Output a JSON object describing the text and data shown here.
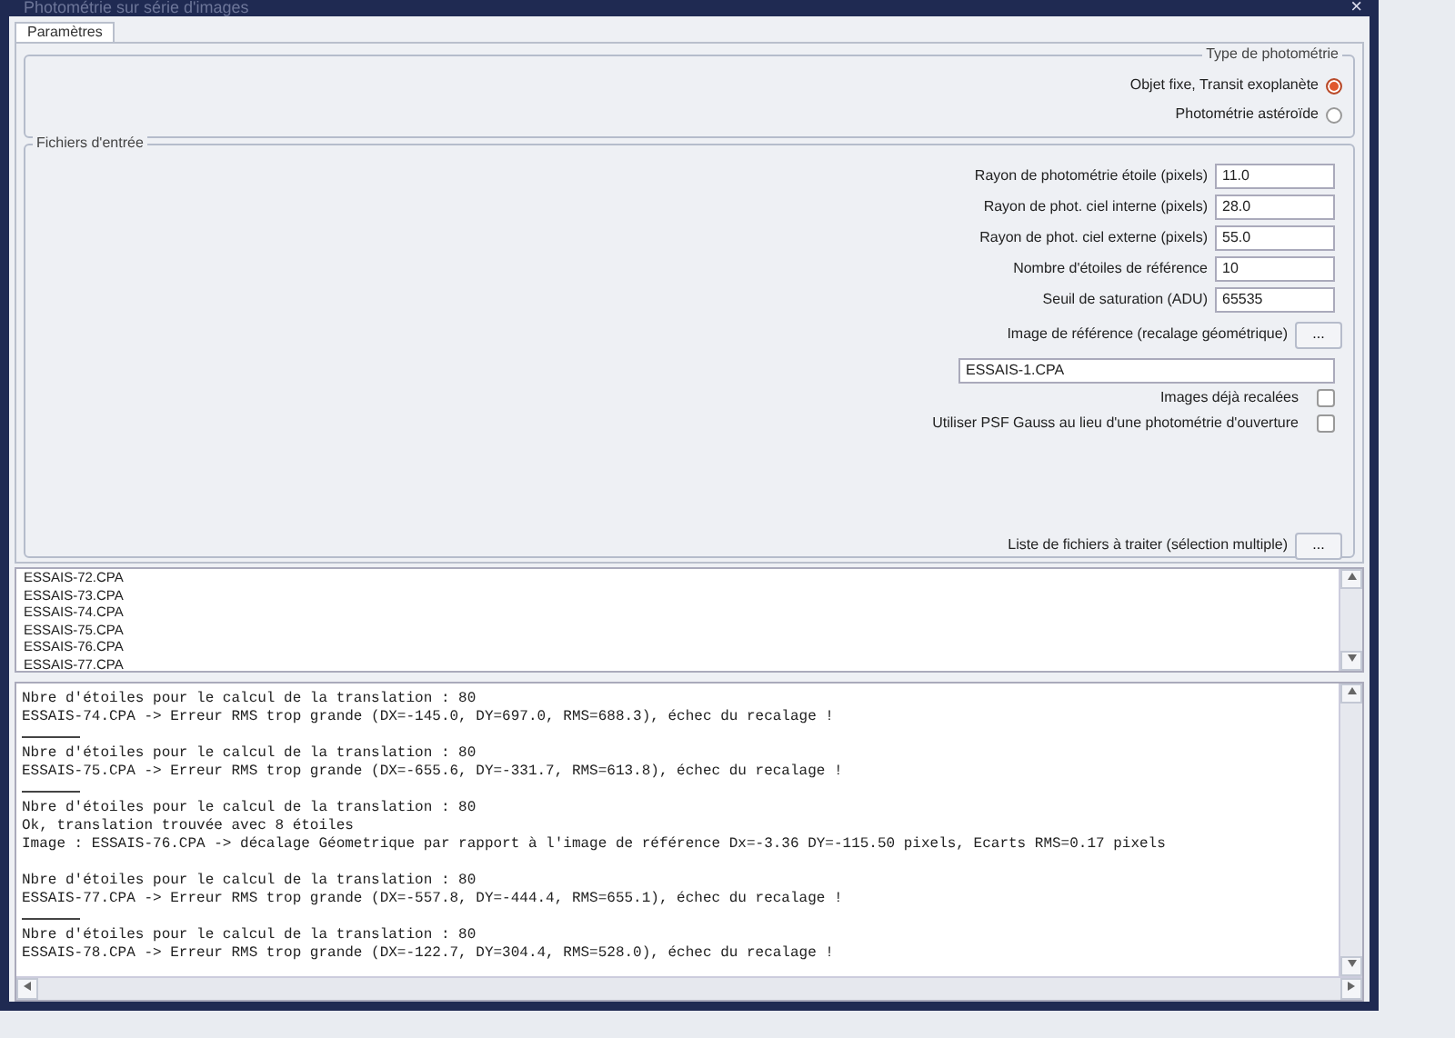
{
  "window": {
    "title": "Photométrie sur série d'images",
    "close": "×"
  },
  "tabs": [
    {
      "label": "Paramètres",
      "selected": true
    }
  ],
  "photometry_type": {
    "legend": "Type de photométrie",
    "options": [
      {
        "label": "Objet fixe, Transit exoplanète",
        "selected": true
      },
      {
        "label": "Photométrie astéroïde",
        "selected": false
      }
    ]
  },
  "input_files": {
    "legend": "Fichiers d'entrée",
    "fields": [
      {
        "label": "Rayon de photométrie étoile (pixels)",
        "value": "11.0"
      },
      {
        "label": "Rayon de phot. ciel interne (pixels)",
        "value": "28.0"
      },
      {
        "label": "Rayon de phot. ciel externe (pixels)",
        "value": "55.0"
      },
      {
        "label": "Nombre d'étoiles de référence",
        "value": "10"
      },
      {
        "label": "Seuil de saturation (ADU)",
        "value": "65535"
      }
    ],
    "reference": {
      "label": "Image de référence (recalage géométrique)",
      "button": "...",
      "value": "ESSAIS-1.CPA"
    },
    "checks": [
      {
        "label": "Images déjà recalées",
        "checked": false
      },
      {
        "label": "Utiliser PSF Gauss au lieu d'une photométrie d'ouverture",
        "checked": false
      }
    ],
    "file_list": {
      "label": "Liste de fichiers à traiter (sélection multiple)",
      "button": "..."
    }
  },
  "files": [
    "ESSAIS-72.CPA",
    "ESSAIS-73.CPA",
    "ESSAIS-74.CPA",
    "ESSAIS-75.CPA",
    "ESSAIS-76.CPA",
    "ESSAIS-77.CPA"
  ],
  "log": [
    {
      "kind": "text",
      "text": "Nbre d'étoiles pour le calcul de la translation : 80"
    },
    {
      "kind": "text",
      "text": "ESSAIS-74.CPA -> Erreur RMS trop grande (DX=-145.0, DY=697.0, RMS=688.3), échec du recalage !"
    },
    {
      "kind": "rule"
    },
    {
      "kind": "text",
      "text": "Nbre d'étoiles pour le calcul de la translation : 80"
    },
    {
      "kind": "text",
      "text": "ESSAIS-75.CPA -> Erreur RMS trop grande (DX=-655.6, DY=-331.7, RMS=613.8), échec du recalage !"
    },
    {
      "kind": "rule"
    },
    {
      "kind": "text",
      "text": "Nbre d'étoiles pour le calcul de la translation : 80"
    },
    {
      "kind": "text",
      "text": "Ok, translation trouvée avec 8 étoiles"
    },
    {
      "kind": "text",
      "text": "Image : ESSAIS-76.CPA -> décalage Géometrique par rapport à l'image de référence Dx=-3.36 DY=-115.50 pixels, Ecarts RMS=0.17 pixels"
    },
    {
      "kind": "blank"
    },
    {
      "kind": "text",
      "text": "Nbre d'étoiles pour le calcul de la translation : 80"
    },
    {
      "kind": "text",
      "text": "ESSAIS-77.CPA -> Erreur RMS trop grande (DX=-557.8, DY=-444.4, RMS=655.1), échec du recalage !"
    },
    {
      "kind": "rule"
    },
    {
      "kind": "text",
      "text": "Nbre d'étoiles pour le calcul de la translation : 80"
    },
    {
      "kind": "text",
      "text": "ESSAIS-78.CPA -> Erreur RMS trop grande (DX=-122.7, DY=304.4, RMS=528.0), échec du recalage !"
    }
  ]
}
